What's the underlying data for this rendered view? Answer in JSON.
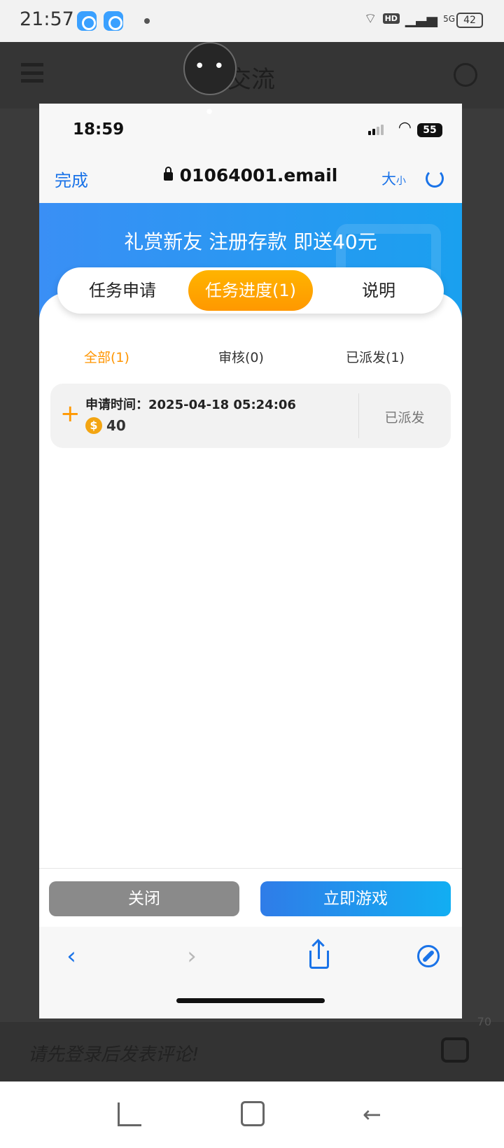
{
  "android_status": {
    "time": "21:57",
    "battery": "42",
    "net": "5G",
    "hd": "HD"
  },
  "background_page": {
    "title": "交流",
    "comment_placeholder": "请先登录后发表评论!",
    "comment_count": "70"
  },
  "overlay": {
    "more": "• • •"
  },
  "ios_status": {
    "time": "18:59",
    "battery": "55"
  },
  "browser": {
    "done": "完成",
    "url": "01064001.email",
    "size_big": "大",
    "size_small": "小"
  },
  "banner": {
    "title": "礼赏新友 注册存款 即送40元"
  },
  "tabs": [
    {
      "label": "任务申请",
      "active": false
    },
    {
      "label": "任务进度(1)",
      "active": true
    },
    {
      "label": "说明",
      "active": false
    }
  ],
  "subtabs": [
    {
      "label": "全部(1)",
      "active": true
    },
    {
      "label": "审核(0)",
      "active": false
    },
    {
      "label": "已派发(1)",
      "active": false
    }
  ],
  "records": [
    {
      "time": "申请时间：2025-04-18 05:24:06",
      "coin": "$",
      "amount": "40",
      "status": "已派发"
    }
  ],
  "actions": {
    "close": "关闭",
    "play": "立即游戏"
  },
  "toolbar": {
    "back": "‹",
    "forward": "›"
  },
  "icons": [
    "back-icon",
    "forward-icon",
    "share-icon",
    "compass-icon",
    "reload-icon",
    "lock-icon"
  ],
  "colors": {
    "accent_blue": "#1a73e8",
    "accent_orange": "#ff9800"
  }
}
